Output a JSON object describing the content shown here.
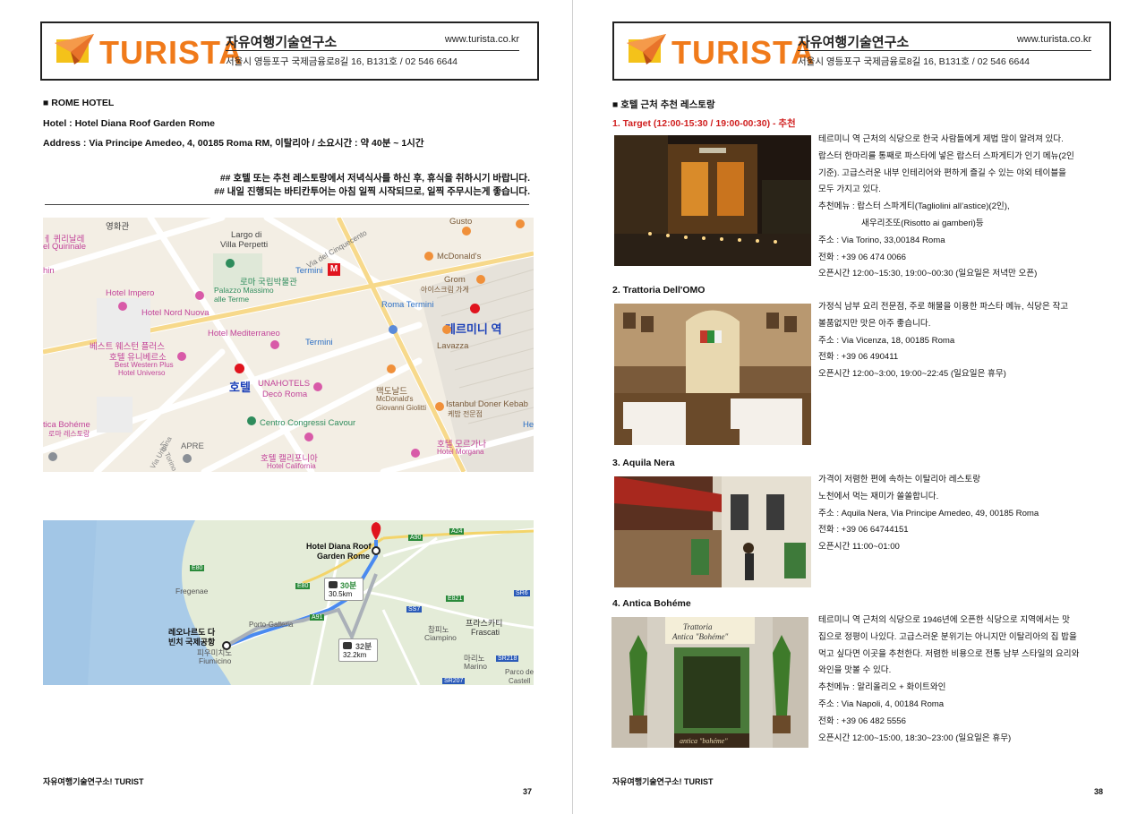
{
  "header": {
    "logo_text": "TURISTA",
    "org_name": "자유여행기술연구소",
    "url": "www.turista.co.kr",
    "address": "서울시 영등포구 국제금융로8길 16, B131호 / 02 546 6644"
  },
  "left_page": {
    "section_title": "■ ROME HOTEL",
    "hotel_line": "Hotel :  Hotel Diana Roof Garden Rome",
    "address_line": "Address : Via Principe Amedeo, 4, 00185 Roma RM, 이탈리아 / 소요시간 : 약 40분 ~ 1시간",
    "note1": "## 호텔 또는 추천 레스토랑에서 저녁식사를 하신 후, 휴식을 취하시기 바랍니다.",
    "note2": "## 내일 진행되는 바티칸투어는 아침 일찍 시작되므로, 일찍 주무시는게 좋습니다.",
    "map1": {
      "labels": {
        "yeonghwagwan": "영화관",
        "quirinale_ko": "ㅔ 퀴리날레",
        "quirinale": "el Quirinale",
        "largo": "Largo di",
        "villa": "Villa Perpetti",
        "via_cinquecento": "Via del Cinquecento",
        "gusto": "Gusto",
        "mcdonalds": "McDonald's",
        "hin": "hin",
        "museum_ko": "로마 국립박물관",
        "museum_1": "Palazzo Massimo",
        "museum_2": "alle Terme",
        "termini": "Termini",
        "grom": "Grom",
        "grom_ko": "아이스크림 가게",
        "hotel_impero": "Hotel Impero",
        "hotel_nord": "Hotel Nord Nuova",
        "roma_termini": "Roma Termini",
        "termini_station_ko": "테르미니 역",
        "hotel_med": "Hotel Mediterraneo",
        "termini2": "Termini",
        "lavazza": "Lavazza",
        "bw_ko1": "베스트 웨스턴 플러스",
        "bw_ko2": "호텔 유니베르소",
        "bw_1": "Best Western Plus",
        "bw_2": "Hotel Universo",
        "hotel_ko": "호텔",
        "una_1": "UNAHOTELS",
        "una_2": "Decò Roma",
        "mc_ko": "맥도날드",
        "mc_2": "McDonald's",
        "mc_3": "Giovanni Giolitti",
        "istanbul": "Istanbul Doner Kebab",
        "istanbul_ko": "케밥 전문점",
        "boheme": "tica Bohéme",
        "boheme_ko": "로마 레스토랑",
        "centro": "Centro Congressi Cavour",
        "apre": "APRE",
        "via_urbana": "Via Urbana",
        "via_torino": "Via Torino",
        "california_ko": "호텔 캘리포니아",
        "california": "Hotel California",
        "morgana_ko": "호텔 모르가나",
        "morgana": "Hotel Morgana",
        "he": "He"
      }
    },
    "map2": {
      "labels": {
        "dest_1": "Hotel Diana Roof",
        "dest_2": "Garden Rome",
        "time1": "30분",
        "dist1": "30.5km",
        "time2": "32분",
        "dist2": "32.2km",
        "fregenae": "Fregenae",
        "airport_1": "레오나르도 다",
        "airport_2": "빈치 국제공항",
        "airport_3": "피우미치노",
        "airport_4": "Fiumicino",
        "porto": "Porto-Galleria",
        "ciampino_ko": "참피노",
        "ciampino": "Ciampino",
        "frascati_ko": "프라스카티",
        "frascati": "Frascati",
        "marino_ko": "마리노",
        "marino": "Marino",
        "parco_1": "Parco de",
        "parco_2": "Castell",
        "e80": "E80",
        "a91": "A91",
        "a24": "A24",
        "e821": "E821",
        "ss7": "SS7",
        "sr6": "SR6",
        "sr218": "SR218",
        "sr207": "SR207",
        "a90": "A90",
        "e80b": "E80"
      }
    },
    "footer": "자유여행기술연구소! TURIST",
    "page_number": "37"
  },
  "right_page": {
    "section_title": "■ 호텔 근처 추천 레스토랑",
    "restaurants": [
      {
        "title": "1. Target (12:00-15:30 / 19:00-00:30) - 추천",
        "lines": [
          "테르미니 역 근처의 식당으로 한국 사람들에게 제법 많이 알려져 있다.",
          "랍스터 한마리를 통째로 파스타에 넣은 랍스터 스파게티가 인기 메뉴(2인",
          "기준). 고급스러운 내부 인테리어와 편하게 즐길 수 있는 야외 테이블을",
          "모두 가지고 있다.",
          "추천메뉴 : 랍스터 스파게티(Tagliolini all’astice)(2인),",
          "           새우리조또(Risotto ai gamberi)등",
          "주소 : Via Torino, 33,00184 Roma",
          "전화 : +39 06 474 0066",
          "오픈시간 12:00~15:30, 19:00~00:30 (일요일은 저녁만 오픈)"
        ]
      },
      {
        "title": "2. Trattoria Dell'OMO",
        "lines": [
          "가정식 남부 요리 전문점, 주로 해물을 이용한 파스타 메뉴, 식당은 작고",
          "볼품없지만 맛은 아주 좋습니다.",
          "주소 : Via Vicenza, 18, 00185 Roma",
          "전화 : +39 06 490411",
          "오픈시간 12:00~3:00, 19:00~22:45 (일요일은 휴무)"
        ]
      },
      {
        "title": "3. Aquila Nera",
        "lines": [
          "가격이 저렴한 편에 속하는 이탈리아 레스토랑",
          "노천에서 먹는 재미가 쏠쏠합니다.",
          "주소 : Aquila Nera, Via Principe Amedeo, 49, 00185 Roma",
          "전화 : +39 06 64744151",
          "오픈시간 11:00~01:00"
        ]
      },
      {
        "title": "4. Antica Bohéme",
        "lines": [
          "테르미니 역 근처의 식당으로 1946년에 오픈한 식당으로 지역에서는 맛",
          "집으로 정평이 나있다. 고급스러운 분위기는 아니지만 이탈리아의 집 밥을",
          "먹고 싶다면 이곳을 추천한다. 저렴한 비용으로 전통 남부 스타일의 요리와",
          "와인을 맛볼 수 있다.",
          "추천메뉴 : 알리올리오 + 화이트와인",
          "주소 : Via Napoli, 4, 00184 Roma",
          "전화 : +39 06 482 5556",
          "오픈시간 12:00~15:00, 18:30~23:00 (일요일은 휴무)"
        ],
        "sign_1": "Trattoria",
        "sign_2": "Antica \"Bohéme\"",
        "sign_3": "antica \"bohéme\""
      }
    ],
    "footer": "자유여행기술연구소! TURIST",
    "page_number": "38"
  },
  "colors": {
    "logo_orange": "#f07a1a",
    "highlight_red": "#d01f1f",
    "map_pink": "#c2449a",
    "map_blue": "#2a6ec4",
    "station_label_blue": "#1a3fb8",
    "route_blue": "#4a8af0"
  }
}
